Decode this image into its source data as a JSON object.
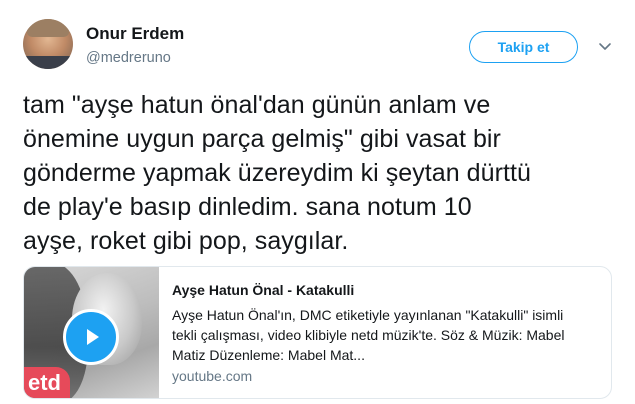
{
  "author": {
    "display_name": "Onur Erdem",
    "handle": "@medreruno"
  },
  "follow_button": {
    "label": "Takip et"
  },
  "tweet": {
    "lines": [
      "tam \"ayşe hatun önal'dan günün anlam ve",
      "önemine uygun parça gelmiş\" gibi vasat bir",
      "gönderme yapmak üzereydim ki şeytan dürttü",
      "de play'e basıp dinledim. sana notum 10",
      "ayşe, roket gibi pop, saygılar."
    ]
  },
  "card": {
    "title": "Ayşe Hatun Önal - Katakulli",
    "description_lines": [
      "Ayşe Hatun Önal'ın, DMC etiketiyle yayınlanan \"Katakulli\" isimli",
      "tekli çalışması, video klibiyle netd müzik'te. Söz & Müzik: Mabel",
      "Matiz Düzenleme: Mabel Mat..."
    ],
    "domain": "youtube.com",
    "thumbnail_logo": "etd"
  },
  "icons": {
    "caret": "chevron-down-icon",
    "play": "play-icon"
  },
  "colors": {
    "accent": "#1da1f2",
    "secondary_text": "#657786",
    "border": "#e1e8ed"
  }
}
